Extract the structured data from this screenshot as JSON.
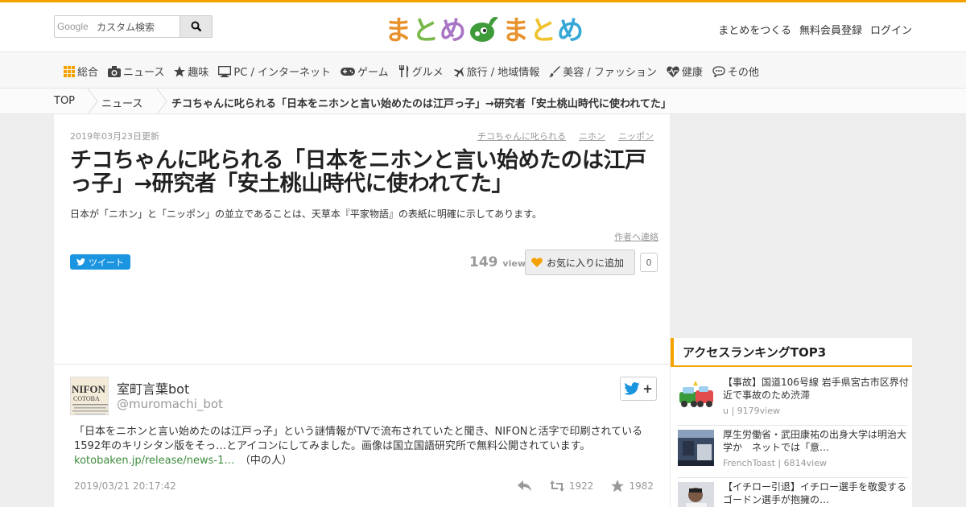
{
  "header": {
    "search_brand": "Google",
    "search_placeholder": "カスタム検索",
    "logo_chars": [
      {
        "char": "ま",
        "color": "#e8922e"
      },
      {
        "char": "と",
        "color": "#79b84a"
      },
      {
        "char": "め",
        "color": "#a874c4"
      },
      {
        "char": "ま",
        "color": "#e8922e"
      },
      {
        "char": "と",
        "color": "#f0c22e"
      },
      {
        "char": "め",
        "color": "#35a7d6"
      }
    ],
    "logo_mascot_color": "#3e9b3a",
    "links": [
      "まとめをつくる",
      "無料会員登録",
      "ログイン"
    ]
  },
  "categories": [
    {
      "label": "総合",
      "icon": "grid-icon"
    },
    {
      "label": "ニュース",
      "icon": "camera-icon"
    },
    {
      "label": "趣味",
      "icon": "star-icon"
    },
    {
      "label": "PC / インターネット",
      "icon": "monitor-icon"
    },
    {
      "label": "ゲーム",
      "icon": "gamepad-icon"
    },
    {
      "label": "グルメ",
      "icon": "cutlery-icon"
    },
    {
      "label": "旅行 / 地域情報",
      "icon": "plane-icon"
    },
    {
      "label": "美容 / ファッション",
      "icon": "brush-icon"
    },
    {
      "label": "健康",
      "icon": "heart-pulse-icon"
    },
    {
      "label": "その他",
      "icon": "chat-icon"
    }
  ],
  "breadcrumb": [
    "TOP",
    "ニュース",
    "チコちゃんに叱られる「日本をニホンと言い始めたのは江戸っ子」→研究者「安土桃山時代に使われてた」"
  ],
  "article": {
    "updated": "2019年03月23日更新",
    "tags": [
      "チコちゃんに叱られる",
      "ニホン",
      "ニッポン"
    ],
    "title": "チコちゃんに叱られる「日本をニホンと言い始めたのは江戸っ子」→研究者「安土桃山時代に使われてた」",
    "description": "日本が「ニホン」と「ニッポン」の並立であることは、天草本『平家物語』の表紙に明確に示してあります。",
    "contact_label": "作者へ連絡",
    "tweet_label": "ツイート",
    "view_count": "149",
    "view_unit": "view",
    "favorite_label": "お気に入りに追加",
    "favorite_count": "0"
  },
  "tweet": {
    "name": "室町言葉bot",
    "handle": "@muromachi_bot",
    "avatar_text": [
      "NIFON",
      "COTOBA"
    ],
    "follow_plus": "+",
    "text": "「日本をニホンと言い始めたのは江戸っ子」という謎情報がTVで流布されていたと聞き、NIFONと活字で印刷されている1592年のキリシタン版をそっ…とアイコンにしてみました。画像は国立国語研究所で無料公開されています。",
    "link": "kotobaken.jp/release/news-1…",
    "suffix": "　（中の人）",
    "time": "2019/03/21 20:17:42",
    "retweets": "1922",
    "likes": "1982"
  },
  "ranking": {
    "title": "アクセスランキングTOP3",
    "items": [
      {
        "title": "【事故】国道106号線 岩手県宮古市区界付近で事故のため渋滞",
        "meta": "u | 9179view"
      },
      {
        "title": "厚生労働省・武田康祐の出身大学は明治大学か　ネットでは「意…",
        "meta": "FrenchToast | 6814view"
      },
      {
        "title": "【イチロー引退】イチロー選手を敬愛するゴードン選手が抱擁の…",
        "meta": ""
      }
    ]
  }
}
